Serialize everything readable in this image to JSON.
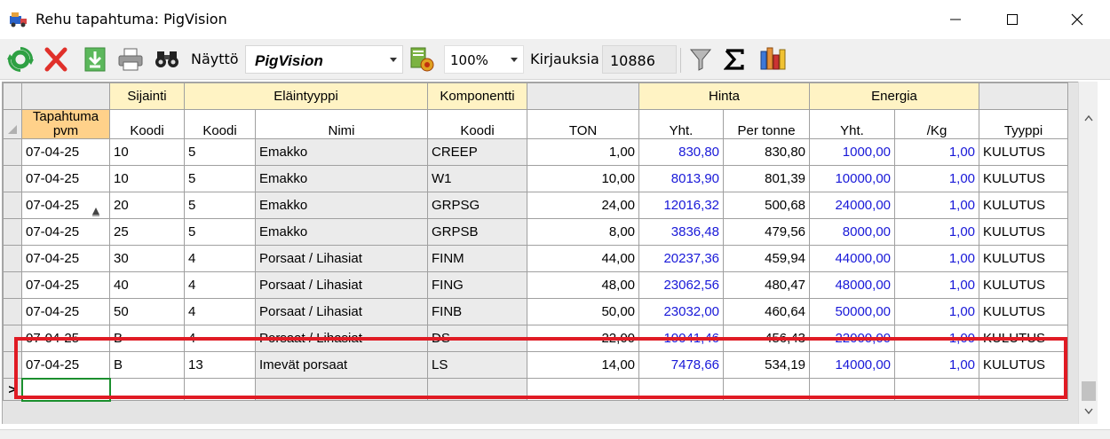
{
  "window": {
    "title": "Rehu tapahtuma: PigVision"
  },
  "toolbar": {
    "naytto_label": "Näyttö",
    "naytto_value": "PigVision",
    "zoom_value": "100%",
    "kirjauksia_label": "Kirjauksia",
    "kirjauksia_value": "10886",
    "icons": [
      "refresh-icon",
      "delete-icon",
      "download-icon",
      "print-icon",
      "binoculars-icon",
      "report-gear-icon",
      "filter-icon",
      "sigma-icon",
      "chart-icon"
    ]
  },
  "grid": {
    "group_headers": {
      "sijainti": "Sijainti",
      "elaintyyppi": "Eläintyyppi",
      "komponentti": "Komponentti",
      "hinta": "Hinta",
      "energia": "Energia"
    },
    "column_headers": {
      "date_line1": "Tapahtuma",
      "date_line2": "pvm",
      "sijainti_koodi": "Koodi",
      "elain_koodi": "Koodi",
      "elain_nimi": "Nimi",
      "komp_koodi": "Koodi",
      "ton": "TON",
      "hinta_yht": "Yht.",
      "per_tonne": "Per tonne",
      "energia_yht": "Yht.",
      "per_kg": "/Kg",
      "tyyppi": "Tyyppi"
    },
    "rows": [
      {
        "pvm": "07-04-25",
        "sij": "10",
        "ekoodi": "5",
        "nimi": "Emakko",
        "komp": "CREEP",
        "ton": "1,00",
        "hinta": "830,80",
        "pertonne": "830,80",
        "energia": "1000,00",
        "perkg": "1,00",
        "tyyppi": "KULUTUS"
      },
      {
        "pvm": "07-04-25",
        "sij": "10",
        "ekoodi": "5",
        "nimi": "Emakko",
        "komp": "W1",
        "ton": "10,00",
        "hinta": "8013,90",
        "pertonne": "801,39",
        "energia": "10000,00",
        "perkg": "1,00",
        "tyyppi": "KULUTUS"
      },
      {
        "pvm": "07-04-25",
        "sij": "20",
        "ekoodi": "5",
        "nimi": "Emakko",
        "komp": "GRPSG",
        "ton": "24,00",
        "hinta": "12016,32",
        "pertonne": "500,68",
        "energia": "24000,00",
        "perkg": "1,00",
        "tyyppi": "KULUTUS"
      },
      {
        "pvm": "07-04-25",
        "sij": "25",
        "ekoodi": "5",
        "nimi": "Emakko",
        "komp": "GRPSB",
        "ton": "8,00",
        "hinta": "3836,48",
        "pertonne": "479,56",
        "energia": "8000,00",
        "perkg": "1,00",
        "tyyppi": "KULUTUS"
      },
      {
        "pvm": "07-04-25",
        "sij": "30",
        "ekoodi": "4",
        "nimi": "Porsaat / Lihasiat",
        "komp": "FINM",
        "ton": "44,00",
        "hinta": "20237,36",
        "pertonne": "459,94",
        "energia": "44000,00",
        "perkg": "1,00",
        "tyyppi": "KULUTUS"
      },
      {
        "pvm": "07-04-25",
        "sij": "40",
        "ekoodi": "4",
        "nimi": "Porsaat / Lihasiat",
        "komp": "FING",
        "ton": "48,00",
        "hinta": "23062,56",
        "pertonne": "480,47",
        "energia": "48000,00",
        "perkg": "1,00",
        "tyyppi": "KULUTUS"
      },
      {
        "pvm": "07-04-25",
        "sij": "50",
        "ekoodi": "4",
        "nimi": "Porsaat / Lihasiat",
        "komp": "FINB",
        "ton": "50,00",
        "hinta": "23032,00",
        "pertonne": "460,64",
        "energia": "50000,00",
        "perkg": "1,00",
        "tyyppi": "KULUTUS"
      },
      {
        "pvm": "07-04-25",
        "sij": "B",
        "ekoodi": "4",
        "nimi": "Porsaat / Lihasiat",
        "komp": "DS",
        "ton": "22,00",
        "hinta": "10041,46",
        "pertonne": "456,43",
        "energia": "22000,00",
        "perkg": "1,00",
        "tyyppi": "KULUTUS"
      },
      {
        "pvm": "07-04-25",
        "sij": "B",
        "ekoodi": "13",
        "nimi": "Imevät porsaat",
        "komp": "LS",
        "ton": "14,00",
        "hinta": "7478,66",
        "pertonne": "534,19",
        "energia": "14000,00",
        "perkg": "1,00",
        "tyyppi": "KULUTUS"
      }
    ],
    "new_row_marker": ">"
  },
  "colors": {
    "blue_values": "#1818d8",
    "header_yellow": "#fff3c4",
    "header_orange": "#ffd18a",
    "highlight_red": "#e01b24",
    "new_cell_green": "#1b8f2e"
  }
}
